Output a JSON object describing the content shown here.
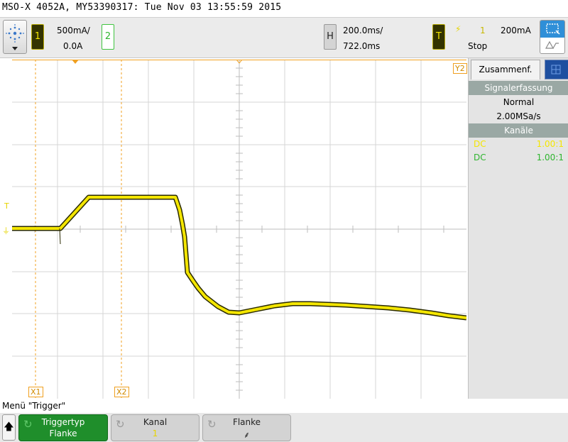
{
  "header": {
    "title": "MSO-X 4052A, MY53390317: Tue Nov 03 13:55:59 2015"
  },
  "channels": {
    "ch1": {
      "number": "1",
      "scale": "500mA/",
      "offset": "0.0A",
      "color": "#f4e600"
    },
    "ch2": {
      "number": "2",
      "color": "#2fb52f"
    }
  },
  "horizontal": {
    "key": "H",
    "scale": "200.0ms/",
    "position": "722.0ms"
  },
  "trigger": {
    "key": "T",
    "slope_symbol": "⚡",
    "source": "1",
    "level": "200mA",
    "mode": "Stop"
  },
  "side_panel": {
    "tab_label": "Zusammenf.",
    "acquisition_header": "Signalerfassung",
    "acquisition_mode": "Normal",
    "sample_rate": "2.00MSa/s",
    "channels_header": "Kanäle",
    "channel_rows": [
      {
        "coupling": "DC",
        "probe": "1.00:1",
        "color": "#f4e600"
      },
      {
        "coupling": "DC",
        "probe": "1.00:1",
        "color": "#2fb52f"
      }
    ]
  },
  "markers": {
    "x1": "X1",
    "x2": "X2",
    "y2": "Y2",
    "trigger_level": "T"
  },
  "menu": {
    "title": "Menü \"Trigger\"",
    "softkeys": [
      {
        "label": "Triggertyp",
        "value": "Flanke"
      },
      {
        "label": "Kanal",
        "value": "1"
      },
      {
        "label": "Flanke",
        "value": "⸙"
      }
    ]
  },
  "icons": {
    "help": "help-burst-icon",
    "autoscale": "autoscale-icon",
    "back": "up-arrow-icon"
  },
  "colors": {
    "trace": "#f4e600",
    "cursor": "#f0a020",
    "grid": "#d6d6d6",
    "softkey_active": "#1f8e2b"
  }
}
